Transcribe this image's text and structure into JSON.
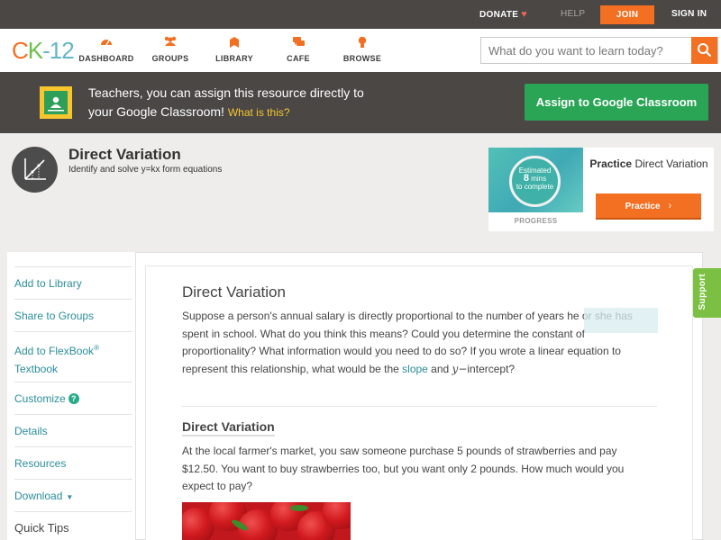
{
  "topbar": {
    "donate": "DONATE",
    "help": "HELP",
    "join": "JOIN",
    "signin": "SIGN IN"
  },
  "header": {
    "logo": {
      "c": "C",
      "k": "K",
      "n": "-12"
    },
    "nav": [
      {
        "label": "DASHBOARD",
        "icon": "dashboard-icon"
      },
      {
        "label": "GROUPS",
        "icon": "groups-icon"
      },
      {
        "label": "LIBRARY",
        "icon": "library-icon"
      },
      {
        "label": "CAFE",
        "icon": "cafe-icon"
      },
      {
        "label": "BROWSE",
        "icon": "browse-icon"
      }
    ],
    "search_placeholder": "What do you want to learn today?"
  },
  "banner": {
    "line1": "Teachers, you can assign this resource directly to",
    "line2": "your Google Classroom!",
    "what_is_this": "What is this?",
    "button": "Assign to Google Classroom"
  },
  "concept": {
    "title": "Direct Variation",
    "subtitle": "Identify and solve y=kx form equations"
  },
  "practice": {
    "estimated": "Estimated",
    "minutes": "8",
    "mins_label": "mins",
    "to_complete": "to complete",
    "progress_label": "PROGRESS",
    "title_bold": "Practice",
    "title_rest": "Direct Variation",
    "button": "Practice"
  },
  "sidebar": {
    "items": [
      {
        "label": "Add to Library"
      },
      {
        "label": "Share to Groups"
      },
      {
        "label": "Add to FlexBook",
        "sup": "®",
        "label2": "Textbook"
      },
      {
        "label": "Customize"
      },
      {
        "label": "Details"
      },
      {
        "label": "Resources"
      },
      {
        "label": "Download"
      }
    ],
    "quick_tips": "Quick Tips"
  },
  "content": {
    "title": "Direct Variation",
    "intro_a": "Suppose a person's annual salary is directly proportional to the number of years he or she has spent in school. What do you think this means? Could you determine the constant of proportionality? What information would you need to do so? If you wrote a linear equation to represent this relationship, what would be the ",
    "intro_slope": "slope",
    "intro_and": " and ",
    "intro_y": "y−",
    "intro_b": "intercept?",
    "section_title": "Direct Variation",
    "section_para": "At the local farmer's market, you saw someone purchase 5 pounds of strawberries and pay $12.50. You want to buy strawberries too, but you want only 2 pounds. How much would you expect to pay?"
  },
  "support": "Support",
  "colors": {
    "orange": "#f36f21",
    "green": "#2aa556",
    "teal_link": "#2a8d9b",
    "dark_bar": "#4a4745",
    "support_green": "#7bc043"
  }
}
